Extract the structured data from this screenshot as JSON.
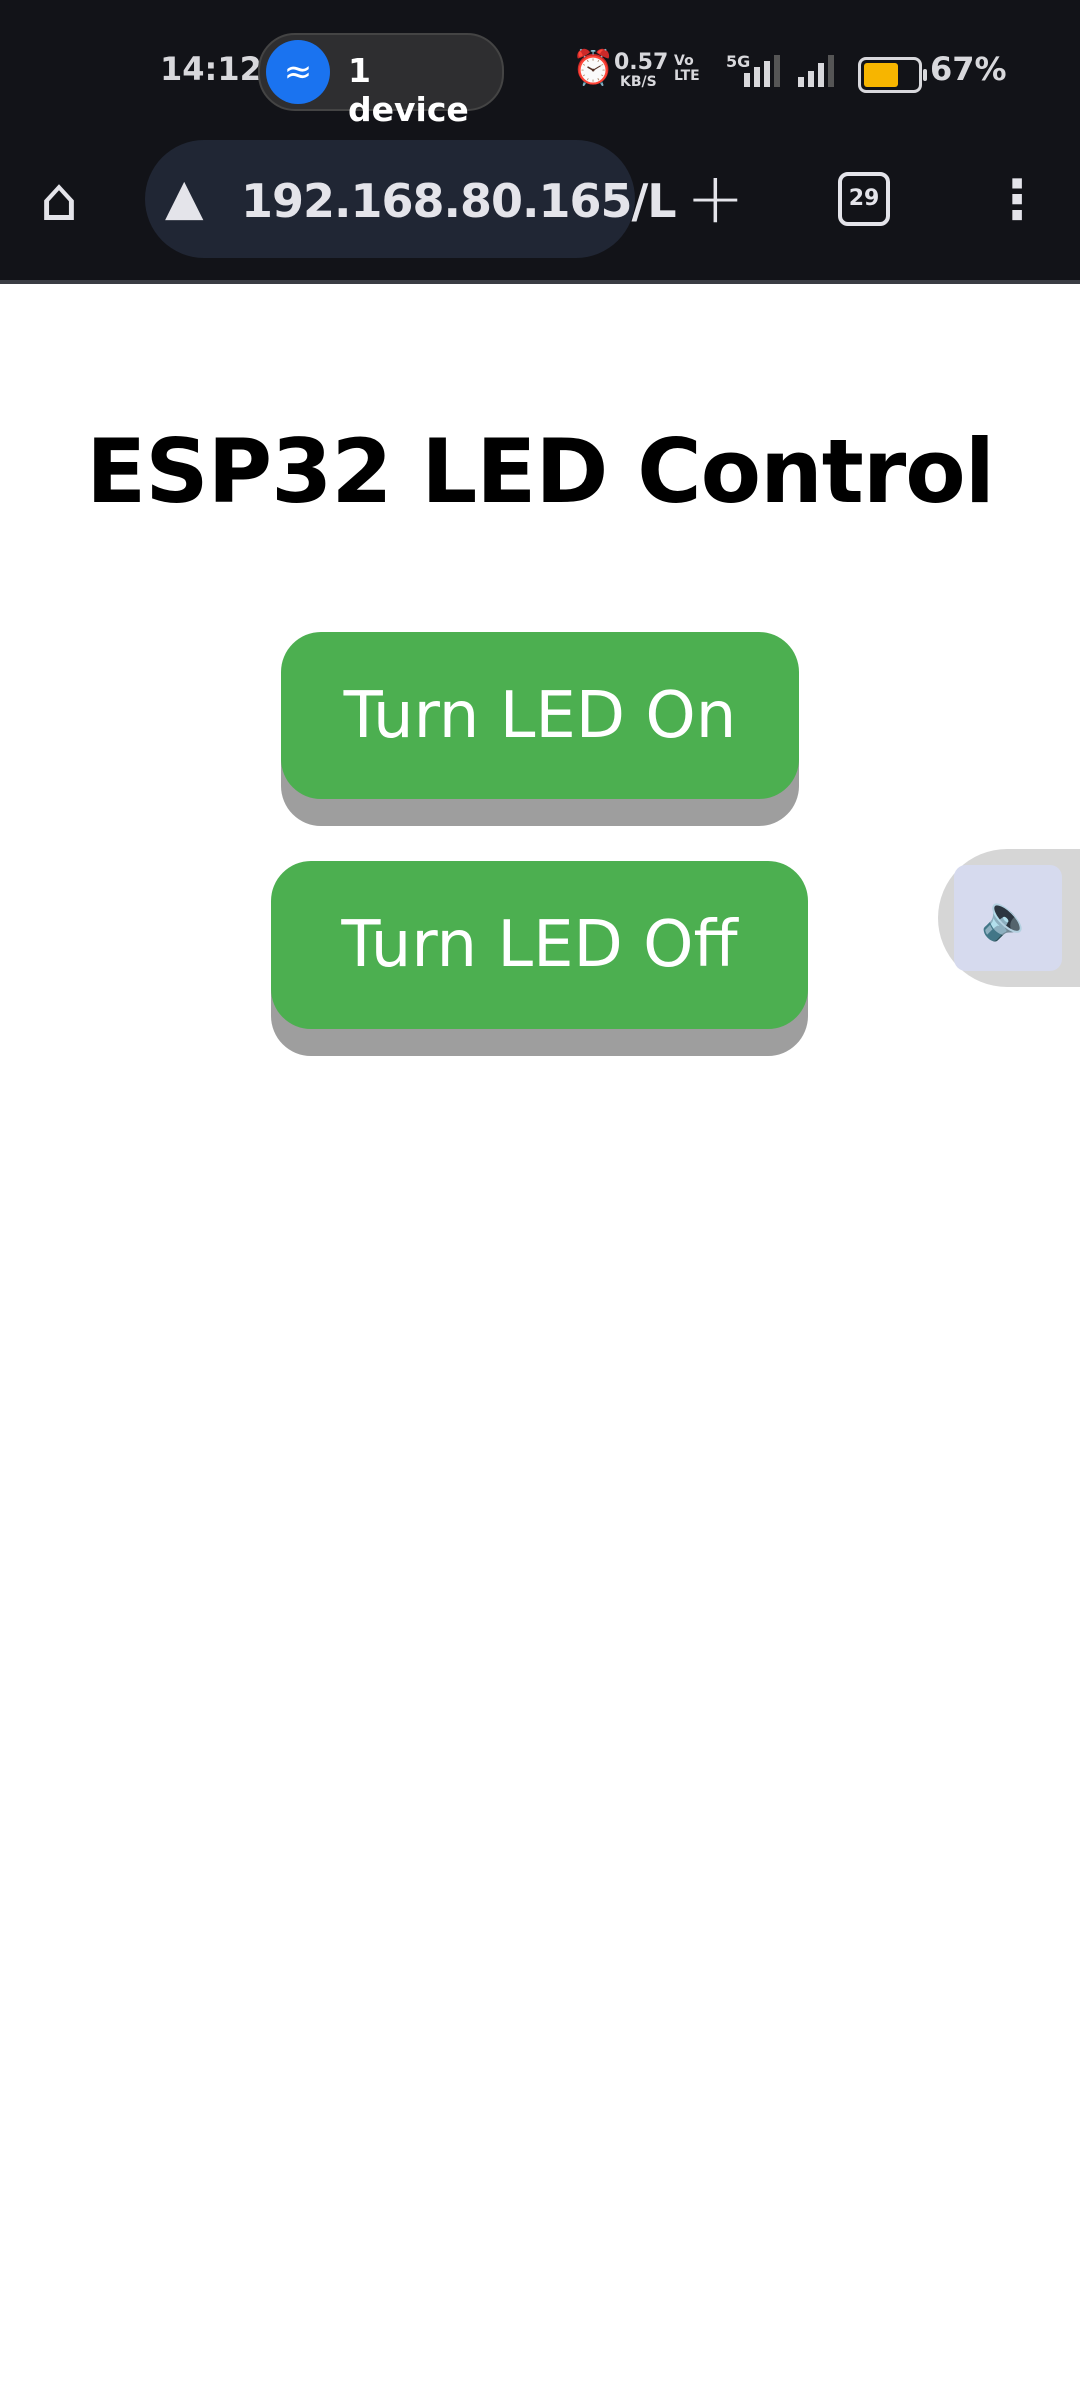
{
  "status_bar": {
    "time": "14:12",
    "hotspot_label": "1 device",
    "net_speed_value": "0.57",
    "net_speed_unit": "KB/S",
    "volte": "Vo LTE",
    "network": "5G",
    "battery_percent": "67%",
    "battery_level": 67,
    "battery_color": "#f7b500"
  },
  "browser": {
    "url": "192.168.80.165/L",
    "tab_count": "29"
  },
  "page": {
    "title": "ESP32 LED Control",
    "on_button": "Turn LED On",
    "off_button": "Turn LED Off",
    "button_color": "#4caf50"
  }
}
